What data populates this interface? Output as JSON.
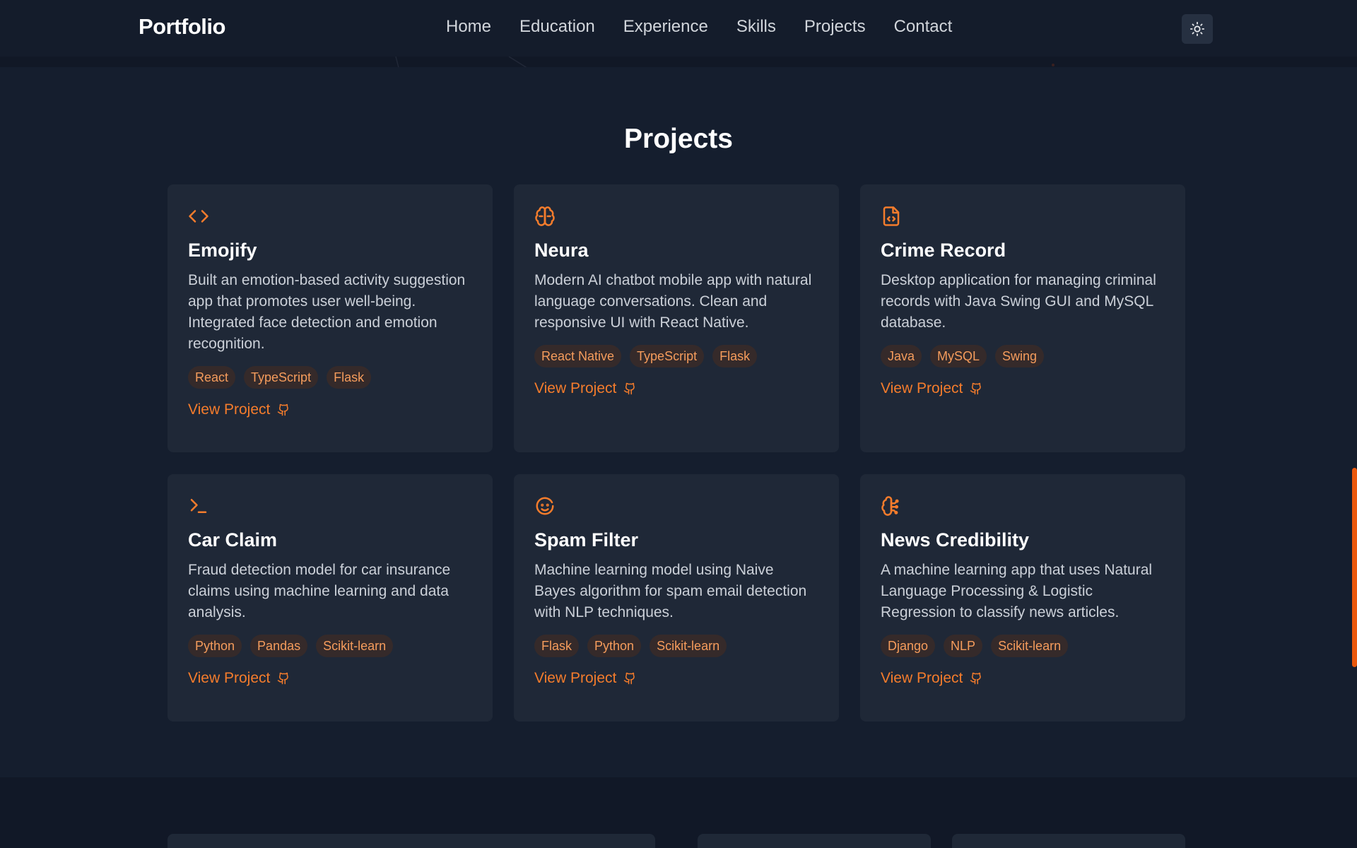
{
  "nav": {
    "brand": "Portfolio",
    "links": [
      "Home",
      "Education",
      "Experience",
      "Skills",
      "Projects",
      "Contact"
    ],
    "theme_icon": "sun-icon"
  },
  "section": {
    "title": "Projects"
  },
  "colors": {
    "accent": "#f47c2c",
    "tag_text": "#f59c5c",
    "card_bg": "#1f2837",
    "page_bg": "#111827"
  },
  "projects": [
    {
      "icon": "code-icon",
      "title": "Emojify",
      "description": "Built an emotion-based activity suggestion app that promotes user well-being. Integrated face detection and emotion recognition.",
      "tags": [
        "React",
        "TypeScript",
        "Flask"
      ],
      "link": "View Project"
    },
    {
      "icon": "brain-icon",
      "title": "Neura",
      "description": "Modern AI chatbot mobile app with natural language conversations. Clean and responsive UI with React Native.",
      "tags": [
        "React Native",
        "TypeScript",
        "Flask"
      ],
      "link": "View Project"
    },
    {
      "icon": "file-code-icon",
      "title": "Crime Record",
      "description": "Desktop application for managing criminal records with Java Swing GUI and MySQL database.",
      "tags": [
        "Java",
        "MySQL",
        "Swing"
      ],
      "link": "View Project"
    },
    {
      "icon": "terminal-icon",
      "title": "Car Claim",
      "description": "Fraud detection model for car insurance claims using machine learning and data analysis.",
      "tags": [
        "Python",
        "Pandas",
        "Scikit-learn"
      ],
      "link": "View Project"
    },
    {
      "icon": "bot-face-icon",
      "title": "Spam Filter",
      "description": "Machine learning model using Naive Bayes algorithm for spam email detection with NLP techniques.",
      "tags": [
        "Flask",
        "Python",
        "Scikit-learn"
      ],
      "link": "View Project"
    },
    {
      "icon": "brain-circuit-icon",
      "title": "News Credibility",
      "description": "A machine learning app that uses Natural Language Processing & Logistic Regression to classify news articles.",
      "tags": [
        "Django",
        "NLP",
        "Scikit-learn"
      ],
      "link": "View Project"
    }
  ]
}
